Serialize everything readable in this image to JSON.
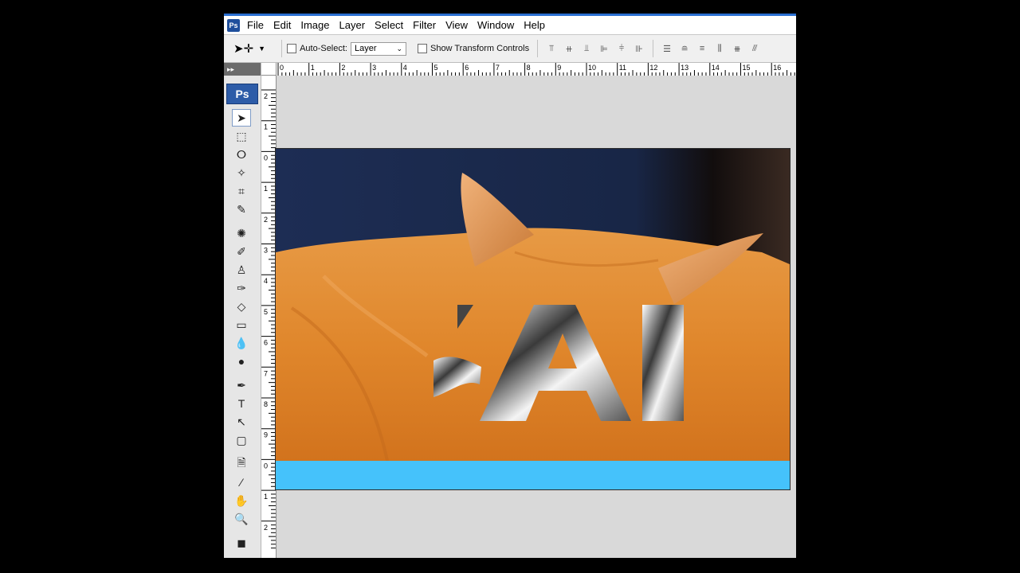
{
  "app": {
    "name": "Photoshop",
    "logo": "Ps"
  },
  "menubar": {
    "items": [
      "File",
      "Edit",
      "Image",
      "Layer",
      "Select",
      "Filter",
      "View",
      "Window",
      "Help"
    ]
  },
  "options": {
    "auto_select_label": "Auto-Select:",
    "auto_select_value": "Layer",
    "show_transform_label": "Show Transform Controls"
  },
  "ruler": {
    "top_numbers": [
      "0",
      "1",
      "2",
      "3",
      "4",
      "5",
      "6",
      "7",
      "8",
      "9",
      "10",
      "11",
      "12",
      "13",
      "14",
      "15",
      "16"
    ],
    "left_numbers": [
      "2",
      "1",
      "0",
      "1",
      "2",
      "3",
      "4",
      "5",
      "6",
      "7",
      "8",
      "9",
      "0",
      "1",
      "2"
    ]
  },
  "toolbox": {
    "tools": [
      {
        "name": "move-tool",
        "glyph": "➤"
      },
      {
        "name": "marquee-tool",
        "glyph": "⬚"
      },
      {
        "name": "lasso-tool",
        "glyph": "ⵔ"
      },
      {
        "name": "magic-wand-tool",
        "glyph": "✧"
      },
      {
        "name": "crop-tool",
        "glyph": "⌗"
      },
      {
        "name": "slice-tool",
        "glyph": "✎"
      },
      {
        "name": "healing-tool",
        "glyph": "✺"
      },
      {
        "name": "brush-tool",
        "glyph": "✐"
      },
      {
        "name": "stamp-tool",
        "glyph": "♙"
      },
      {
        "name": "history-brush-tool",
        "glyph": "✑"
      },
      {
        "name": "eraser-tool",
        "glyph": "◇"
      },
      {
        "name": "gradient-tool",
        "glyph": "▭"
      },
      {
        "name": "blur-tool",
        "glyph": "💧"
      },
      {
        "name": "dodge-tool",
        "glyph": "●"
      },
      {
        "name": "pen-tool",
        "glyph": "✒"
      },
      {
        "name": "type-tool",
        "glyph": "T"
      },
      {
        "name": "path-select-tool",
        "glyph": "↖"
      },
      {
        "name": "shape-tool",
        "glyph": "▢"
      },
      {
        "name": "notes-tool",
        "glyph": "🗎"
      },
      {
        "name": "eyedropper-tool",
        "glyph": "⁄"
      },
      {
        "name": "hand-tool",
        "glyph": "✋"
      },
      {
        "name": "zoom-tool",
        "glyph": "🔍"
      },
      {
        "name": "color-swatch",
        "glyph": "◼"
      }
    ]
  },
  "colors": {
    "canvas_blue": "#45c2fb",
    "fur": "#e3882c",
    "background_dark": "#1b2b4d"
  }
}
